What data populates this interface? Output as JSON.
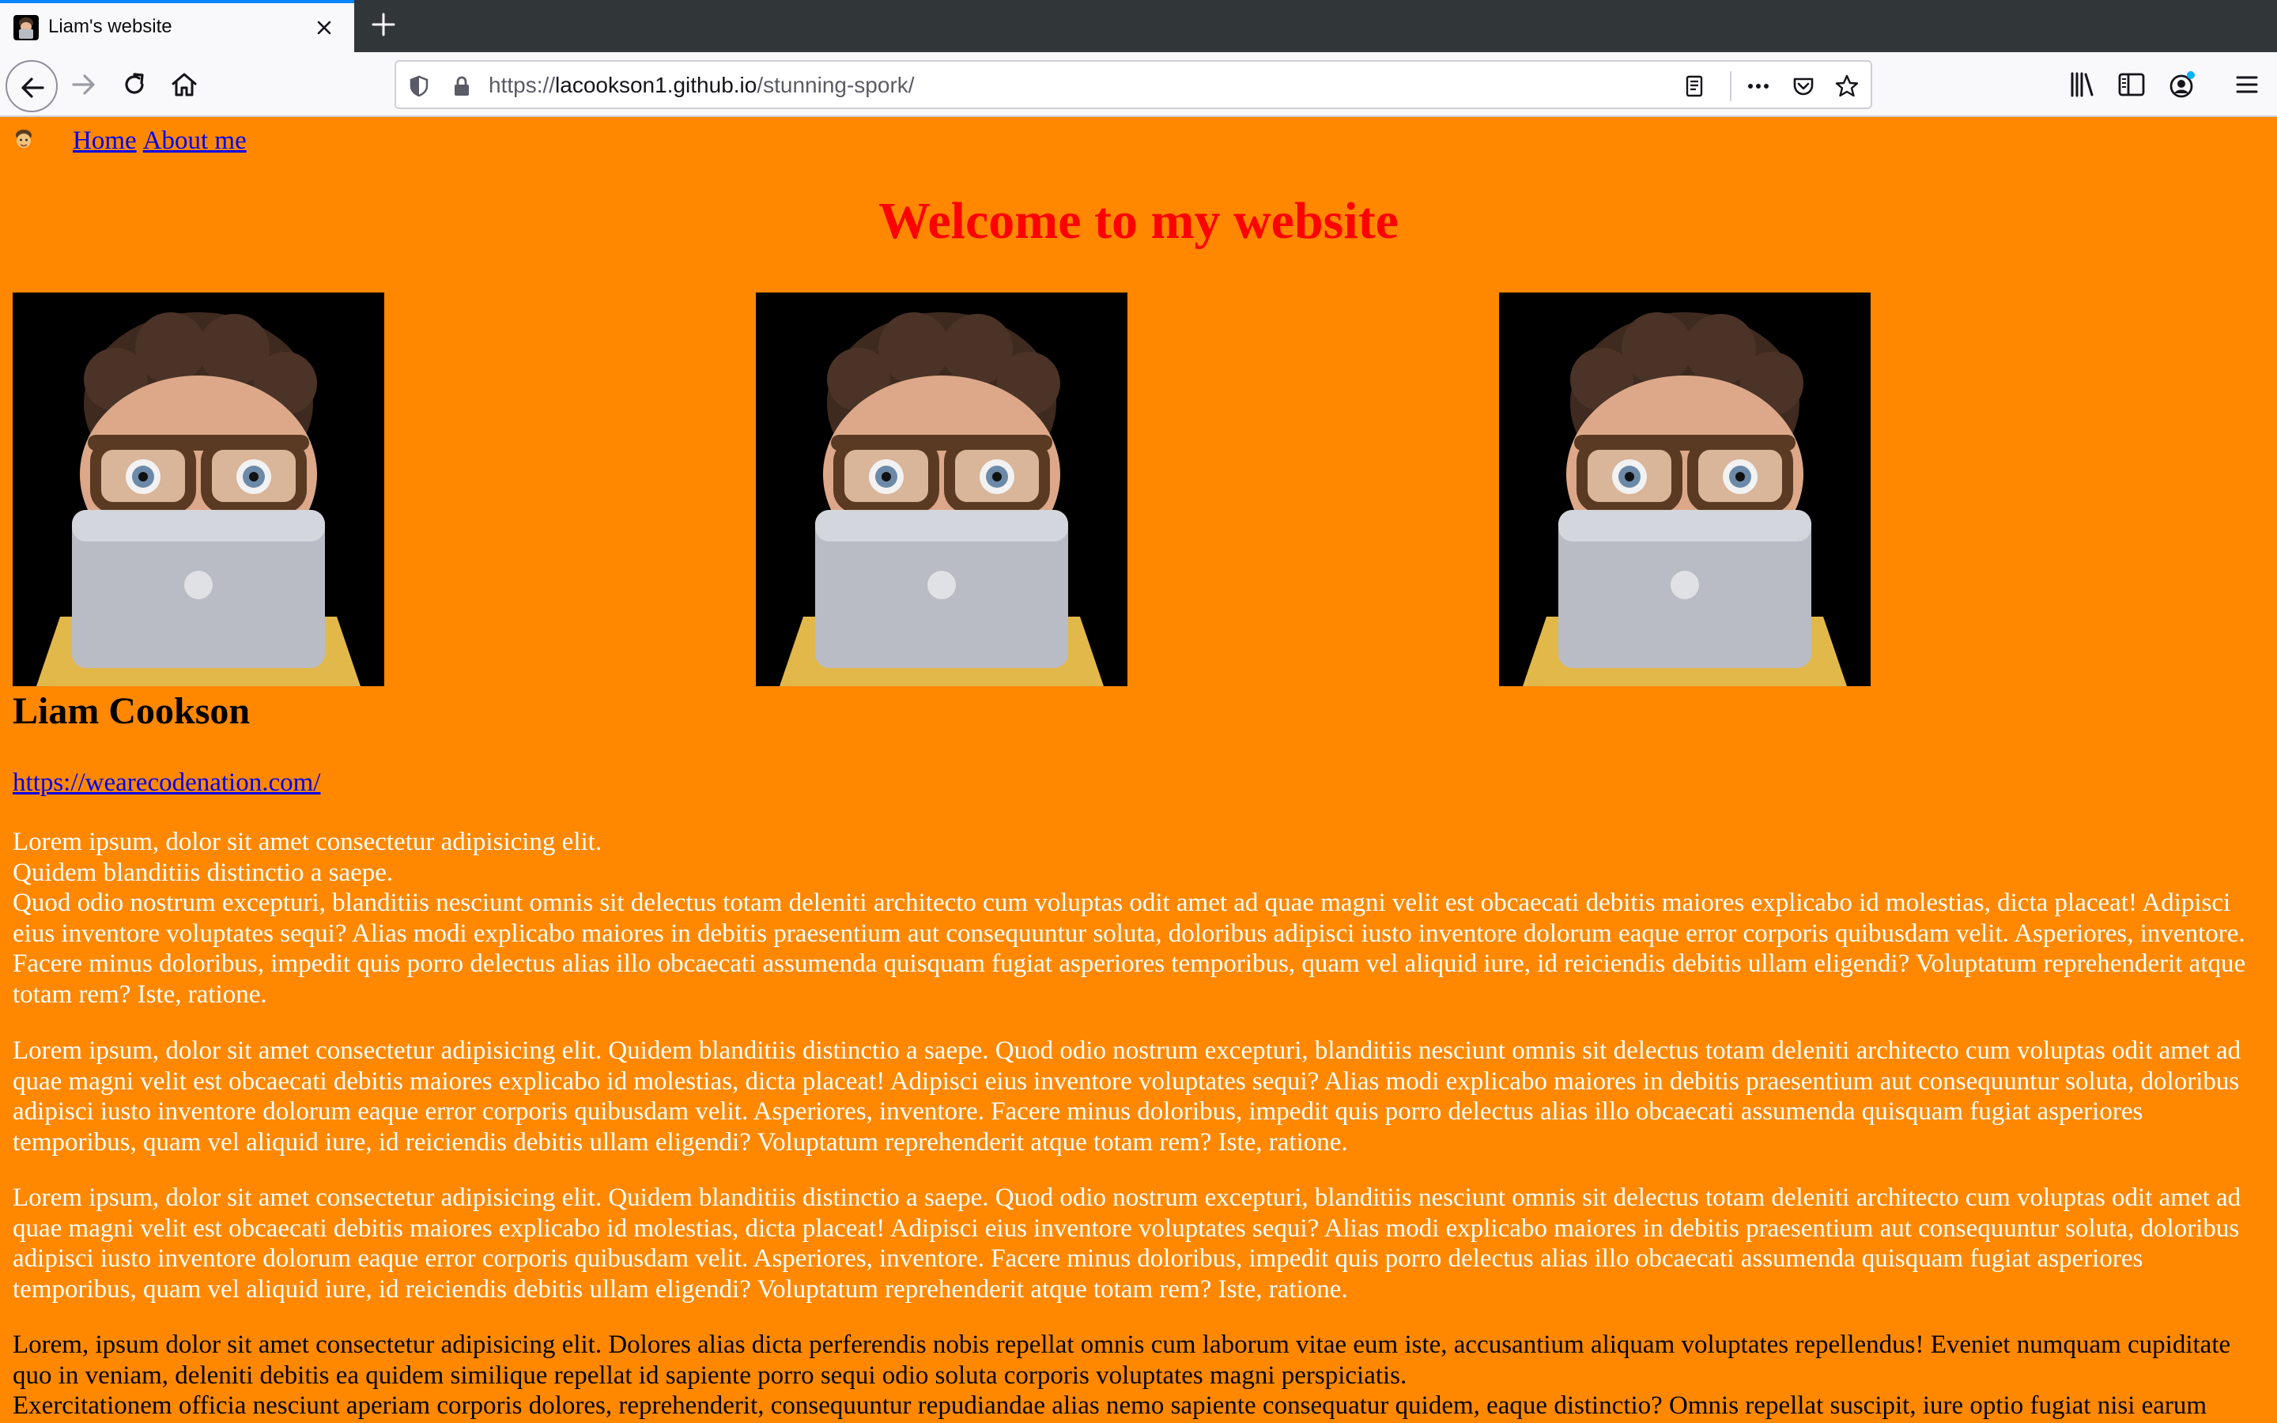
{
  "browser": {
    "tab_title": "Liam's website",
    "url_prefix": "https://",
    "url_host": "lacookson1.github.io",
    "url_path": "/stunning-spork/",
    "icons": [
      "back-icon",
      "forward-icon",
      "reload-icon",
      "home-icon",
      "shield-icon",
      "lock-icon",
      "reader-view-icon",
      "more-icon",
      "pocket-icon",
      "bookmark-star-icon",
      "library-icon",
      "sidebar-icon",
      "account-icon",
      "menu-icon"
    ]
  },
  "nav": {
    "home_label": "Home",
    "about_label": "About me"
  },
  "heading": "Welcome to my website",
  "profile": {
    "name": "Liam Cookson",
    "link": "https://wearecodenation.com/"
  },
  "paragraphs": {
    "p1_line1": "Lorem ipsum, dolor sit amet consectetur adipisicing elit.",
    "p1_line2": "Quidem blanditiis distinctio a saepe.",
    "p1_line3": "Quod odio nostrum excepturi, blanditiis nesciunt omnis sit delectus totam deleniti architecto cum voluptas odit amet ad quae magni velit est obcaecati debitis maiores explicabo id molestias, dicta placeat! Adipisci eius inventore voluptates sequi? Alias modi explicabo maiores in debitis praesentium aut consequuntur soluta, doloribus adipisci iusto inventore dolorum eaque error corporis quibusdam velit. Asperiores, inventore. Facere minus doloribus, impedit quis porro delectus alias illo obcaecati assumenda quisquam fugiat asperiores temporibus, quam vel aliquid iure, id reiciendis debitis ullam eligendi? Voluptatum reprehenderit atque totam rem? Iste, ratione.",
    "p2": "Lorem ipsum, dolor sit amet consectetur adipisicing elit. Quidem blanditiis distinctio a saepe. Quod odio nostrum excepturi, blanditiis nesciunt omnis sit delectus totam deleniti architecto cum voluptas odit amet ad quae magni velit est obcaecati debitis maiores explicabo id molestias, dicta placeat! Adipisci eius inventore voluptates sequi? Alias modi explicabo maiores in debitis praesentium aut consequuntur soluta, doloribus adipisci iusto inventore dolorum eaque error corporis quibusdam velit. Asperiores, inventore. Facere minus doloribus, impedit quis porro delectus alias illo obcaecati assumenda quisquam fugiat asperiores temporibus, quam vel aliquid iure, id reiciendis debitis ullam eligendi? Voluptatum reprehenderit atque totam rem? Iste, ratione.",
    "p3": "Lorem ipsum, dolor sit amet consectetur adipisicing elit. Quidem blanditiis distinctio a saepe. Quod odio nostrum excepturi, blanditiis nesciunt omnis sit delectus totam deleniti architecto cum voluptas odit amet ad quae magni velit est obcaecati debitis maiores explicabo id molestias, dicta placeat! Adipisci eius inventore voluptates sequi? Alias modi explicabo maiores in debitis praesentium aut consequuntur soluta, doloribus adipisci iusto inventore dolorum eaque error corporis quibusdam velit. Asperiores, inventore. Facere minus doloribus, impedit quis porro delectus alias illo obcaecati assumenda quisquam fugiat asperiores temporibus, quam vel aliquid iure, id reiciendis debitis ullam eligendi? Voluptatum reprehenderit atque totam rem? Iste, ratione.",
    "p4_line1": "Lorem, ipsum dolor sit amet consectetur adipisicing elit. Dolores alias dicta perferendis nobis repellat omnis cum laborum vitae eum iste, accusantium aliquam voluptates repellendus! Eveniet numquam cupiditate quo in veniam, deleniti debitis ea quidem similique repellat id sapiente porro sequi odio soluta corporis voluptates magni perspiciatis.",
    "p4_line2": "Exercitationem officia nesciunt aperiam corporis dolores, reprehenderit, consequuntur repudiandae alias nemo sapiente consequatur quidem, eaque distinctio? Omnis repellat suscipit, iure optio fugiat nisi earum corrupti est"
  },
  "colors": {
    "page_background": "#ff8800",
    "heading": "#ff0000",
    "link": "#0000ee",
    "paragraph_text": "#ffffff"
  }
}
